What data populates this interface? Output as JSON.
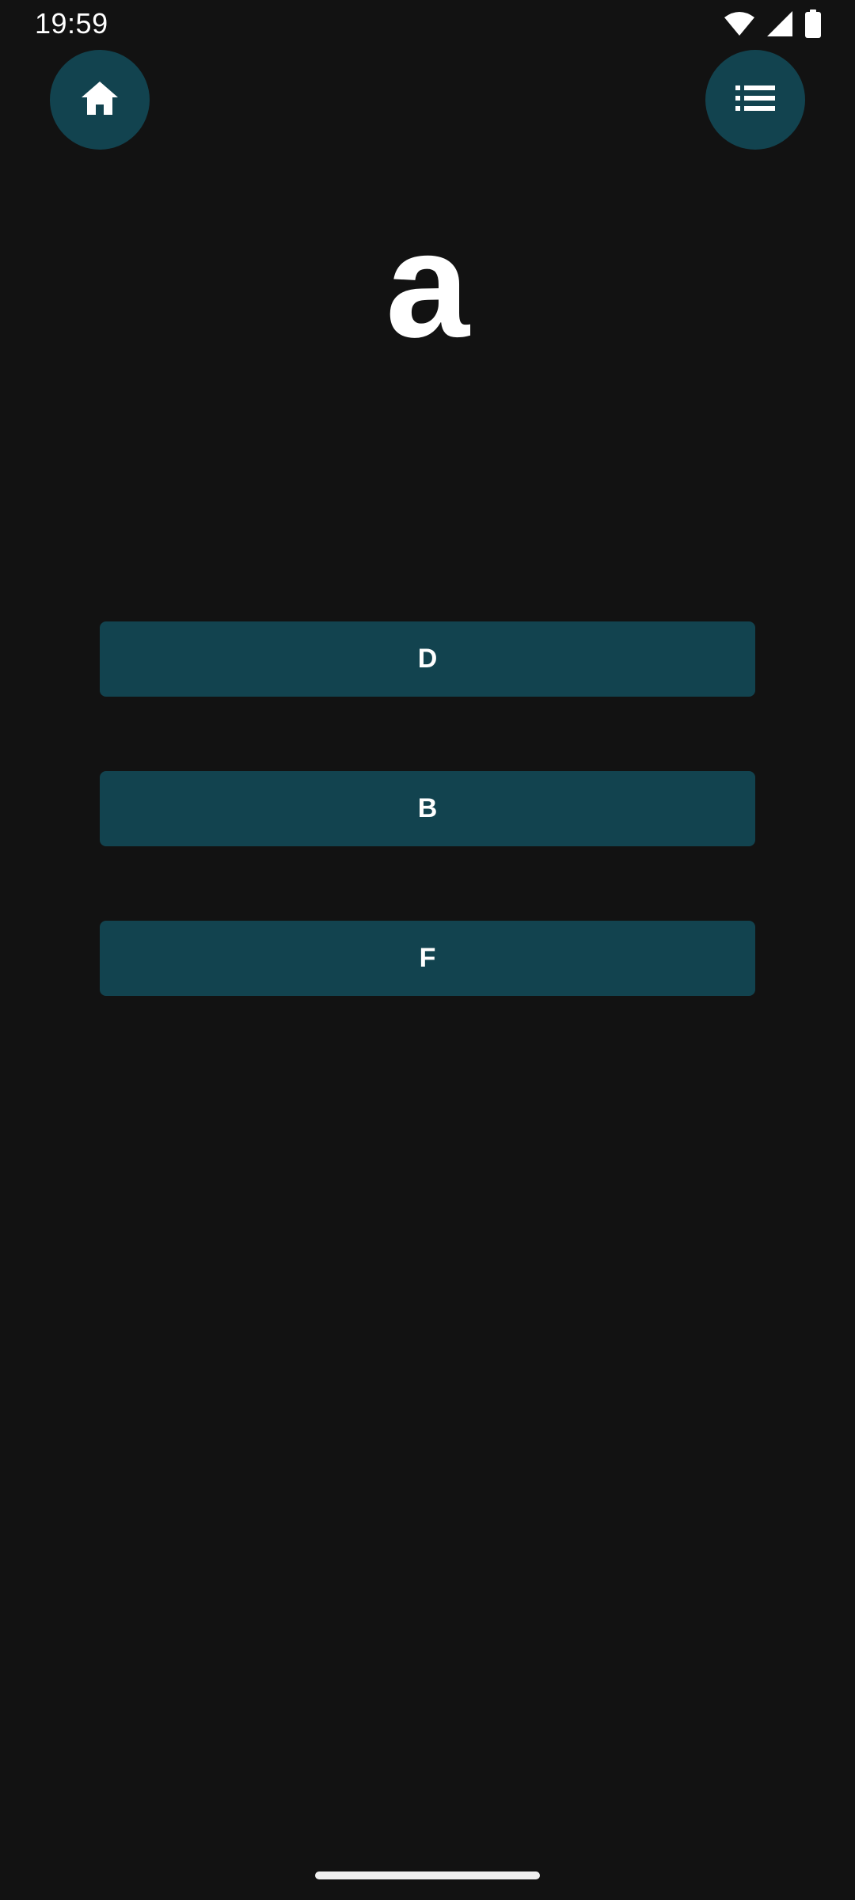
{
  "status_bar": {
    "time": "19:59",
    "icons": [
      "wifi-icon",
      "cellular-signal-icon",
      "battery-icon"
    ]
  },
  "top_actions": {
    "home_icon": "home-icon",
    "list_icon": "list-icon"
  },
  "quiz": {
    "prompt": "a",
    "answers": [
      {
        "label": "D"
      },
      {
        "label": "B"
      },
      {
        "label": "F"
      }
    ]
  },
  "colors": {
    "background": "#121212",
    "accent": "#12434f",
    "text": "#ffffff"
  }
}
